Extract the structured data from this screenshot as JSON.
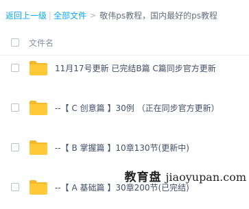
{
  "breadcrumb": {
    "back": "返回上一级",
    "separator": "|",
    "all_files": "全部文件",
    "arrow": ">",
    "current": "敬伟ps教程，国内最好的ps教程"
  },
  "list": {
    "column_header": "文件名",
    "items": [
      {
        "name": "11月17号更新 已完结B篇 C篇同步官方更新",
        "icon": "folder-icon"
      },
      {
        "name": "--【 C 创意篇 】30例 （正在同步官方更新）",
        "icon": "folder-icon"
      },
      {
        "name": "--【 B 掌握篇 】10章130节(更新中)",
        "icon": "folder-icon"
      },
      {
        "name": "--【 A 基础篇 】30章200节(已完结)",
        "icon": "folder-icon"
      }
    ]
  },
  "watermark": {
    "cn": "教育盘",
    "url": "jiaoyupan.com"
  },
  "colors": {
    "link": "#09aaff",
    "folder": "#ffc938",
    "folder_tab": "#f5b82a"
  }
}
